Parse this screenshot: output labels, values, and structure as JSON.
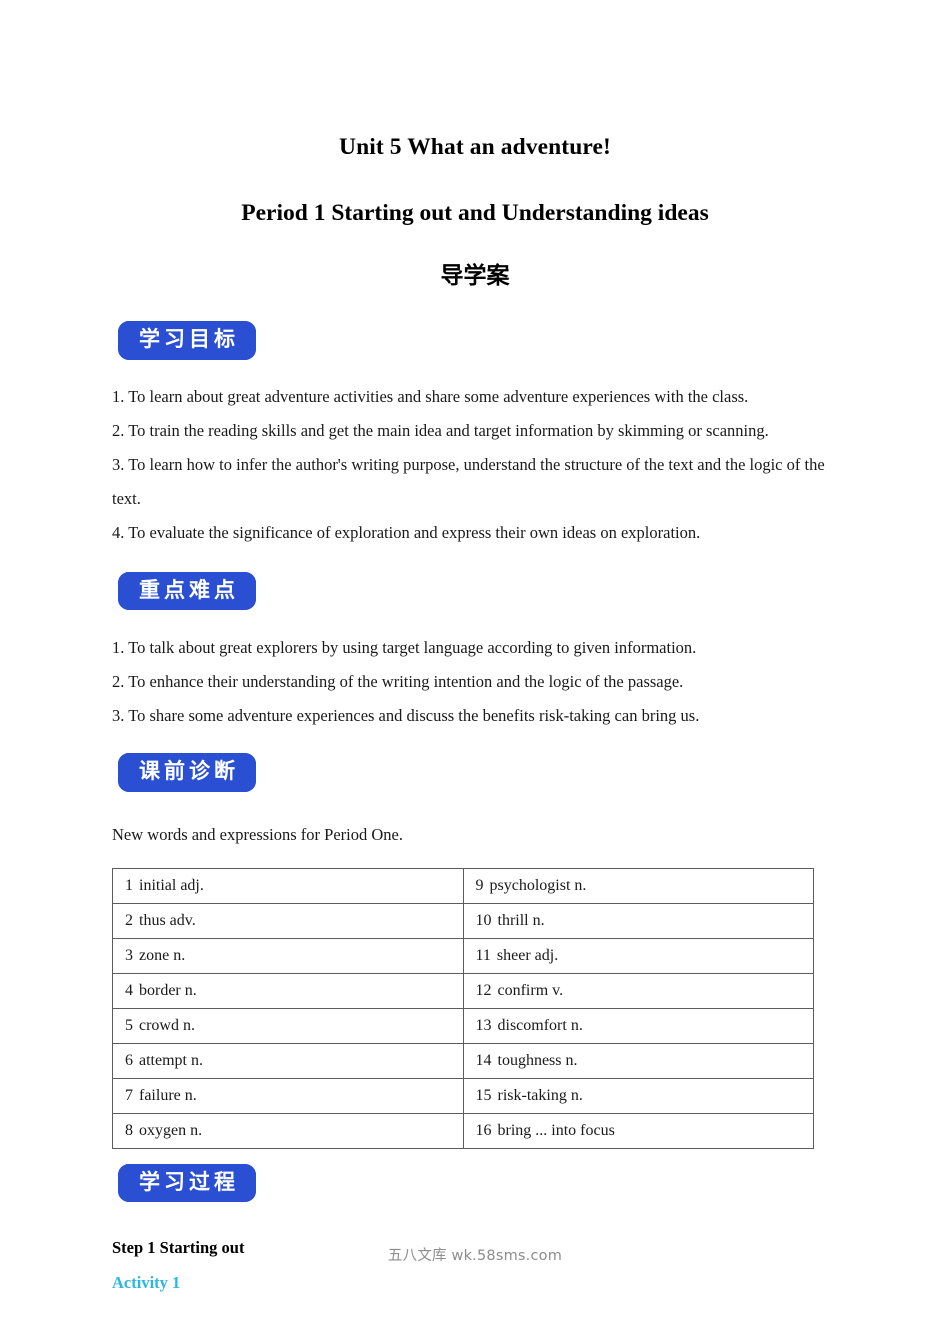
{
  "document": {
    "title": "Unit 5 What an adventure!",
    "subtitle": "Period 1 Starting out and Understanding ideas",
    "cn_title": "导学案"
  },
  "colors": {
    "badge_blue": "#2b4fd2",
    "activity_cyan": "#29b6e8",
    "table_border": "#5c5c5c",
    "footer_gray": "#8d8d8d"
  },
  "sections": {
    "objectives": {
      "badge": "学习目标",
      "items": [
        "1. To learn about great adventure activities and share some adventure experiences with the class.",
        "2. To train the reading skills and get the main idea and target information by skimming or scanning.",
        "3. To learn how to infer the author's writing purpose, understand the structure of the text and the logic of the text.",
        "4. To evaluate the significance of exploration and express their own ideas on exploration."
      ]
    },
    "key_points": {
      "badge": "重点难点",
      "items": [
        "1. To talk about great explorers by using target language according to given information.",
        "2. To enhance their understanding of the writing intention and the logic of the passage.",
        "3. To share some adventure experiences and discuss the benefits risk-taking can bring us."
      ]
    },
    "pre_class_diagnosis": {
      "badge": "课前诊断",
      "intro": "New words and expressions for Period One.",
      "vocabulary": [
        {
          "num": "1",
          "word": "initial  adj."
        },
        {
          "num": "2",
          "word": "thus  adv."
        },
        {
          "num": "3",
          "word": "zone  n."
        },
        {
          "num": "4",
          "word": "border  n."
        },
        {
          "num": "5",
          "word": "crowd  n."
        },
        {
          "num": "6",
          "word": "attempt  n."
        },
        {
          "num": "7",
          "word": "failure  n."
        },
        {
          "num": "8",
          "word": "oxygen  n."
        },
        {
          "num": "9",
          "word": "psychologist  n."
        },
        {
          "num": "10",
          "word": "thrill  n."
        },
        {
          "num": "11",
          "word": "sheer  adj."
        },
        {
          "num": "12",
          "word": "confirm  v."
        },
        {
          "num": "13",
          "word": "discomfort  n."
        },
        {
          "num": "14",
          "word": "toughness  n."
        },
        {
          "num": "15",
          "word": "risk-taking  n."
        },
        {
          "num": "16",
          "word": "bring ... into focus"
        }
      ]
    },
    "learning_process": {
      "badge": "学习过程",
      "step_heading": "Step 1  Starting out",
      "activity_heading": "Activity 1"
    }
  },
  "footer": {
    "watermark": "五八文库 wk.58sms.com"
  }
}
